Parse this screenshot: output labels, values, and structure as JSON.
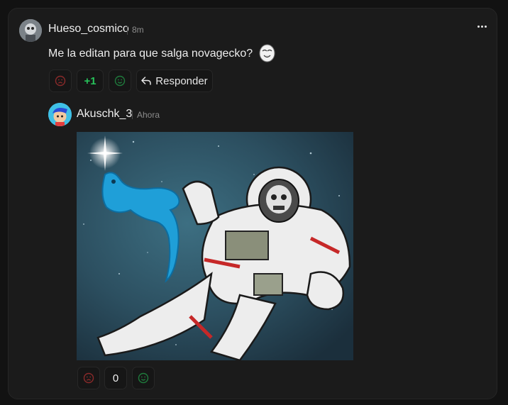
{
  "comment": {
    "author": "Hueso_cosmico",
    "time": "8m",
    "text": "Me la editan para que salga novagecko?",
    "score": "+1",
    "reply_label": "Responder",
    "colors": {
      "score": "#27c25a",
      "downvote": "#8a2a2a",
      "upvote": "#1f7a3c"
    }
  },
  "reply": {
    "author": "Akuschk_3",
    "time": "Ahora",
    "score": "0"
  },
  "icons": {
    "more": "more-dots-icon",
    "downvote": "frown-face-icon",
    "upvote": "smile-face-icon",
    "reply": "reply-arrow-icon"
  }
}
